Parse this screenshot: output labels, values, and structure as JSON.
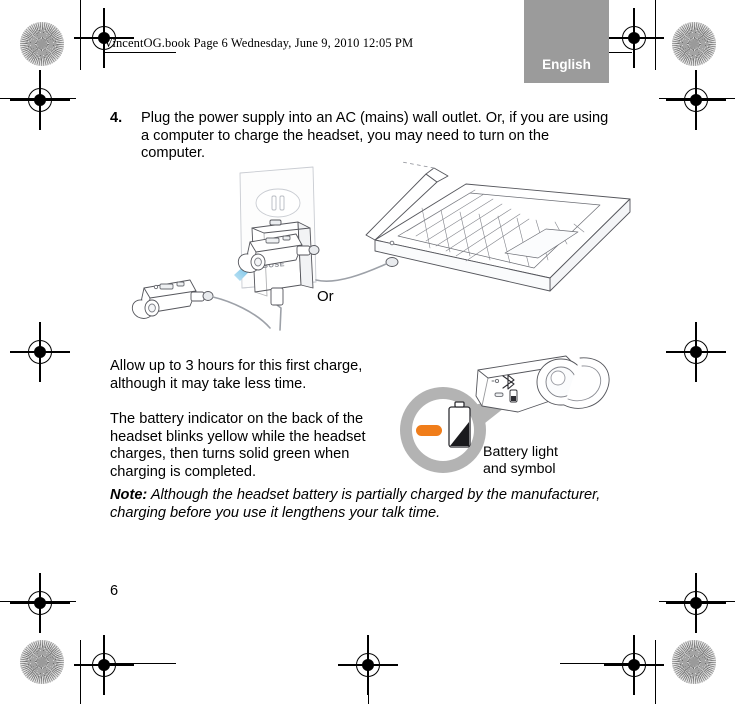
{
  "header": {
    "file_line": "VincentOG.book  Page 6  Wednesday, June 9, 2010  12:05 PM",
    "language_tab": "English",
    "tab_color": "#9b9b9b"
  },
  "step": {
    "number": "4.",
    "text": "Plug the power supply into an AC (mains) wall outlet. Or, if you are using a computer to charge the headset, you may need to turn on the computer."
  },
  "figure_top": {
    "or_label": "Or",
    "adapter_brand": "BOSE",
    "arrow_color": "#1b9ad6"
  },
  "paragraphs": {
    "charge_time": "Allow up to 3 hours for this first charge, although it may take less time.",
    "indicator": "The battery indicator on the back of the headset blinks yellow while the headset charges, then turns solid green when charging is completed."
  },
  "note": {
    "label": "Note:",
    "text": "Although the headset battery is partially charged by the manufacturer, charging before you use it lengthens your talk time."
  },
  "figure_bottom": {
    "caption_line1": "Battery light",
    "caption_line2": "and symbol",
    "led_color": "#f07d1a",
    "callout_color": "#b3b3b3"
  },
  "footer": {
    "page_number": "6"
  }
}
